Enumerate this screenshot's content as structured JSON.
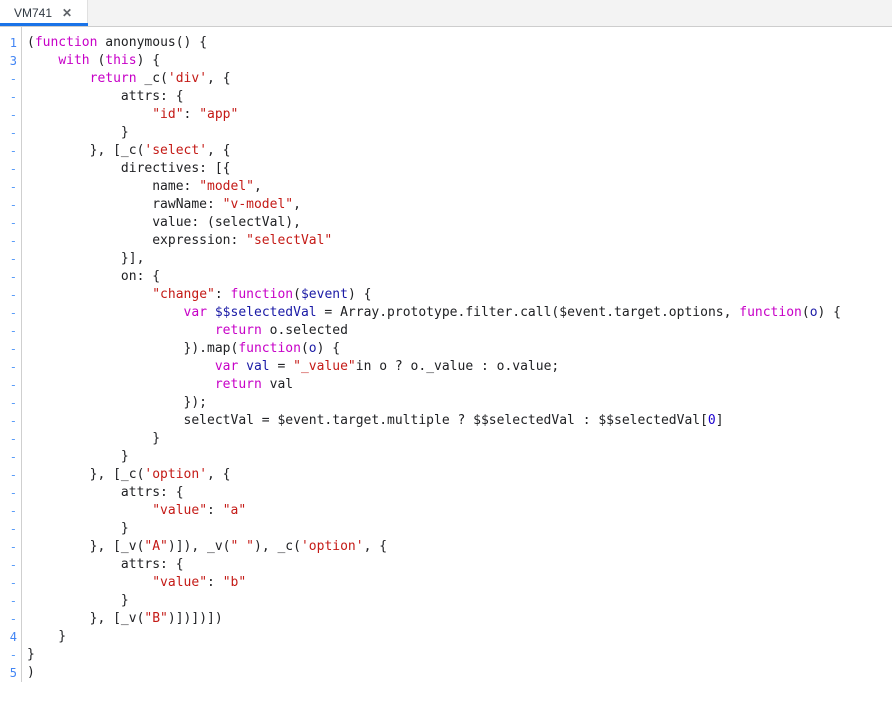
{
  "tab": {
    "title": "VM741",
    "close_label": "✕",
    "accent_color": "#1a73e8"
  },
  "editor": {
    "gutter": [
      "1",
      "3",
      "-",
      "-",
      "-",
      "-",
      "-",
      "-",
      "-",
      "-",
      "-",
      "-",
      "-",
      "-",
      "-",
      "-",
      "-",
      "-",
      "-",
      "-",
      "-",
      "-",
      "-",
      "-",
      "-",
      "-",
      "-",
      "-",
      "-",
      "-",
      "-",
      "-",
      "-",
      "4",
      "-",
      "5"
    ],
    "lines": [
      [
        {
          "t": "(",
          "c": "p"
        },
        {
          "t": "function",
          "c": "k"
        },
        {
          "t": " anonymous() {",
          "c": "p"
        }
      ],
      [
        {
          "t": "    ",
          "c": "p"
        },
        {
          "t": "with",
          "c": "k"
        },
        {
          "t": " (",
          "c": "p"
        },
        {
          "t": "this",
          "c": "k"
        },
        {
          "t": ") {",
          "c": "p"
        }
      ],
      [
        {
          "t": "        ",
          "c": "p"
        },
        {
          "t": "return",
          "c": "k"
        },
        {
          "t": " _c(",
          "c": "p"
        },
        {
          "t": "'div'",
          "c": "s"
        },
        {
          "t": ", {",
          "c": "p"
        }
      ],
      [
        {
          "t": "            attrs: {",
          "c": "p"
        }
      ],
      [
        {
          "t": "                ",
          "c": "p"
        },
        {
          "t": "\"id\"",
          "c": "s"
        },
        {
          "t": ": ",
          "c": "p"
        },
        {
          "t": "\"app\"",
          "c": "s"
        }
      ],
      [
        {
          "t": "            }",
          "c": "p"
        }
      ],
      [
        {
          "t": "        }, [_c(",
          "c": "p"
        },
        {
          "t": "'select'",
          "c": "s"
        },
        {
          "t": ", {",
          "c": "p"
        }
      ],
      [
        {
          "t": "            directives: [{",
          "c": "p"
        }
      ],
      [
        {
          "t": "                name: ",
          "c": "p"
        },
        {
          "t": "\"model\"",
          "c": "s"
        },
        {
          "t": ",",
          "c": "p"
        }
      ],
      [
        {
          "t": "                rawName: ",
          "c": "p"
        },
        {
          "t": "\"v-model\"",
          "c": "s"
        },
        {
          "t": ",",
          "c": "p"
        }
      ],
      [
        {
          "t": "                value: (selectVal),",
          "c": "p"
        }
      ],
      [
        {
          "t": "                expression: ",
          "c": "p"
        },
        {
          "t": "\"selectVal\"",
          "c": "s"
        }
      ],
      [
        {
          "t": "            }],",
          "c": "p"
        }
      ],
      [
        {
          "t": "            on: {",
          "c": "p"
        }
      ],
      [
        {
          "t": "                ",
          "c": "p"
        },
        {
          "t": "\"change\"",
          "c": "s"
        },
        {
          "t": ": ",
          "c": "p"
        },
        {
          "t": "function",
          "c": "k"
        },
        {
          "t": "(",
          "c": "p"
        },
        {
          "t": "$event",
          "c": "v"
        },
        {
          "t": ") {",
          "c": "p"
        }
      ],
      [
        {
          "t": "                    ",
          "c": "p"
        },
        {
          "t": "var",
          "c": "k"
        },
        {
          "t": " ",
          "c": "p"
        },
        {
          "t": "$$selectedVal",
          "c": "v"
        },
        {
          "t": " = Array.prototype.filter.call($event.target.options, ",
          "c": "p"
        },
        {
          "t": "function",
          "c": "k"
        },
        {
          "t": "(",
          "c": "p"
        },
        {
          "t": "o",
          "c": "v"
        },
        {
          "t": ") {",
          "c": "p"
        }
      ],
      [
        {
          "t": "                        ",
          "c": "p"
        },
        {
          "t": "return",
          "c": "k"
        },
        {
          "t": " o.selected",
          "c": "p"
        }
      ],
      [
        {
          "t": "                    }).map(",
          "c": "p"
        },
        {
          "t": "function",
          "c": "k"
        },
        {
          "t": "(",
          "c": "p"
        },
        {
          "t": "o",
          "c": "v"
        },
        {
          "t": ") {",
          "c": "p"
        }
      ],
      [
        {
          "t": "                        ",
          "c": "p"
        },
        {
          "t": "var",
          "c": "k"
        },
        {
          "t": " ",
          "c": "p"
        },
        {
          "t": "val",
          "c": "v"
        },
        {
          "t": " = ",
          "c": "p"
        },
        {
          "t": "\"_value\"",
          "c": "s"
        },
        {
          "t": "in o ? o._value : o.value;",
          "c": "p"
        }
      ],
      [
        {
          "t": "                        ",
          "c": "p"
        },
        {
          "t": "return",
          "c": "k"
        },
        {
          "t": " val",
          "c": "p"
        }
      ],
      [
        {
          "t": "                    });",
          "c": "p"
        }
      ],
      [
        {
          "t": "                    selectVal = $event.target.multiple ? $$selectedVal : $$selectedVal[",
          "c": "p"
        },
        {
          "t": "0",
          "c": "n"
        },
        {
          "t": "]",
          "c": "p"
        }
      ],
      [
        {
          "t": "                }",
          "c": "p"
        }
      ],
      [
        {
          "t": "            }",
          "c": "p"
        }
      ],
      [
        {
          "t": "        }, [_c(",
          "c": "p"
        },
        {
          "t": "'option'",
          "c": "s"
        },
        {
          "t": ", {",
          "c": "p"
        }
      ],
      [
        {
          "t": "            attrs: {",
          "c": "p"
        }
      ],
      [
        {
          "t": "                ",
          "c": "p"
        },
        {
          "t": "\"value\"",
          "c": "s"
        },
        {
          "t": ": ",
          "c": "p"
        },
        {
          "t": "\"a\"",
          "c": "s"
        }
      ],
      [
        {
          "t": "            }",
          "c": "p"
        }
      ],
      [
        {
          "t": "        }, [_v(",
          "c": "p"
        },
        {
          "t": "\"A\"",
          "c": "s"
        },
        {
          "t": ")]), _v(",
          "c": "p"
        },
        {
          "t": "\" \"",
          "c": "s"
        },
        {
          "t": "), _c(",
          "c": "p"
        },
        {
          "t": "'option'",
          "c": "s"
        },
        {
          "t": ", {",
          "c": "p"
        }
      ],
      [
        {
          "t": "            attrs: {",
          "c": "p"
        }
      ],
      [
        {
          "t": "                ",
          "c": "p"
        },
        {
          "t": "\"value\"",
          "c": "s"
        },
        {
          "t": ": ",
          "c": "p"
        },
        {
          "t": "\"b\"",
          "c": "s"
        }
      ],
      [
        {
          "t": "            }",
          "c": "p"
        }
      ],
      [
        {
          "t": "        }, [_v(",
          "c": "p"
        },
        {
          "t": "\"B\"",
          "c": "s"
        },
        {
          "t": ")])])])",
          "c": "p"
        }
      ],
      [
        {
          "t": "    }",
          "c": "p"
        }
      ],
      [
        {
          "t": "}",
          "c": "p"
        }
      ],
      [
        {
          "t": ")",
          "c": "p"
        }
      ],
      []
    ]
  }
}
